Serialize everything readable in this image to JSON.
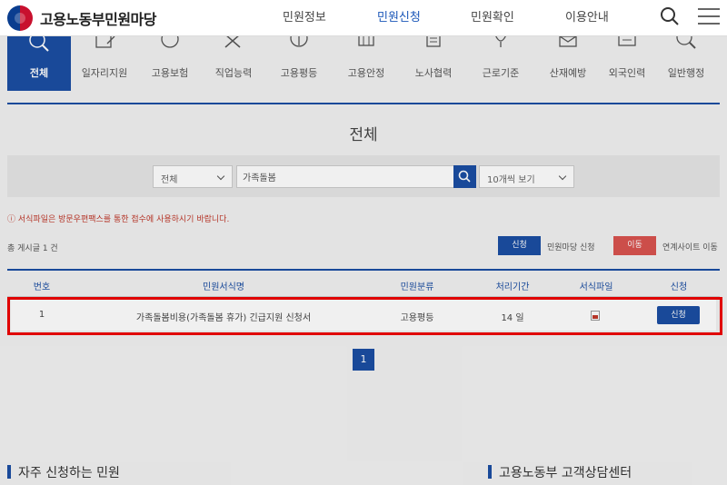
{
  "header": {
    "logo_text": "고용노동부민원마당",
    "nav": [
      {
        "label": "민원정보",
        "active": false
      },
      {
        "label": "민원신청",
        "active": true
      },
      {
        "label": "민원확인",
        "active": false
      },
      {
        "label": "이용안내",
        "active": false
      }
    ],
    "icons": [
      "search-icon",
      "hamburger-menu-icon"
    ]
  },
  "categories": [
    {
      "label": "전체",
      "active": true
    },
    {
      "label": "일자리지원"
    },
    {
      "label": "고용보험"
    },
    {
      "label": "직업능력"
    },
    {
      "label": "고용평등"
    },
    {
      "label": "고용안정"
    },
    {
      "label": "노사협력"
    },
    {
      "label": "근로기준"
    },
    {
      "label": "산재예방"
    },
    {
      "label": "외국인력"
    },
    {
      "label": "일반행정"
    }
  ],
  "page_title": "전체",
  "search": {
    "scope_value": "전체",
    "keyword_value": "가족돌봄",
    "page_size_value": "10개씩 보기"
  },
  "notice": "ⓘ 서식파일은 방문우편팩스를 통한 접수에 사용하시기 바랍니다.",
  "total": "총 게시글 1 건",
  "legend": {
    "apply_badge": "신청",
    "apply_text": "민원마당 신청",
    "move_badge": "이동",
    "move_text": "연계사이트 이동",
    "apply_color": "#1b4ea3",
    "move_color": "#d9534f"
  },
  "table": {
    "headers": [
      "번호",
      "민원서식명",
      "민원분류",
      "처리기간",
      "서식파일",
      "신청"
    ],
    "rows": [
      {
        "no": "1",
        "name": "가족돌봄비용(가족돌봄 휴가) 긴급지원 신청서",
        "category": "고용평등",
        "period": "14 일",
        "apply_label": "신청"
      }
    ]
  },
  "pagination": {
    "current": "1"
  },
  "sections": {
    "frequent": "자주 신청하는 민원",
    "center": "고용노동부 고객상담센터"
  },
  "colors": {
    "accent": "#1b4ea3",
    "highlight": "#ee0000"
  }
}
